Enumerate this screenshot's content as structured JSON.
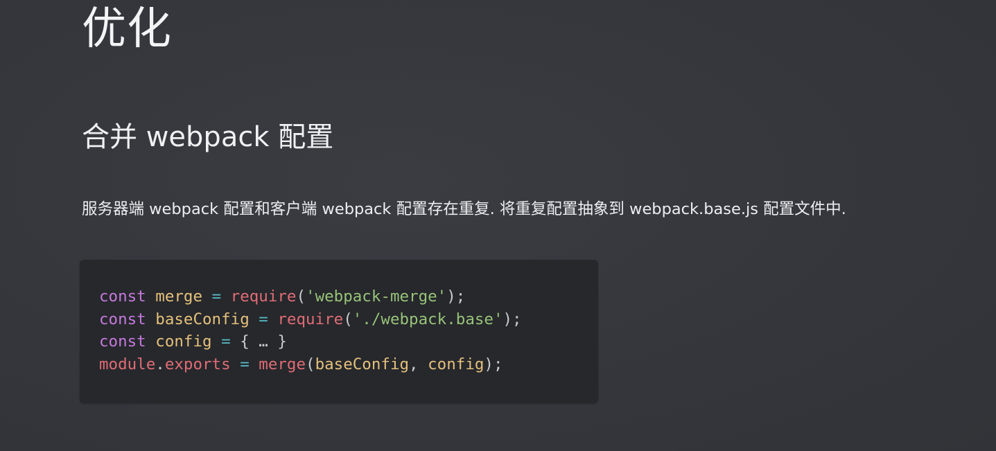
{
  "heading": "优化",
  "subheading": "合并 webpack 配置",
  "paragraph": "服务器端 webpack 配置和客户端 webpack 配置存在重复. 将重复配置抽象到 webpack.base.js 配置文件中.",
  "code_block": {
    "lines": [
      [
        {
          "type": "kw",
          "text": "const"
        },
        {
          "type": "punc",
          "text": " "
        },
        {
          "type": "var",
          "text": "merge"
        },
        {
          "type": "punc",
          "text": " "
        },
        {
          "type": "op",
          "text": "="
        },
        {
          "type": "punc",
          "text": " "
        },
        {
          "type": "fn",
          "text": "require"
        },
        {
          "type": "punc",
          "text": "("
        },
        {
          "type": "str",
          "text": "'webpack-merge'"
        },
        {
          "type": "punc",
          "text": ");"
        }
      ],
      [
        {
          "type": "kw",
          "text": "const"
        },
        {
          "type": "punc",
          "text": " "
        },
        {
          "type": "var",
          "text": "baseConfig"
        },
        {
          "type": "punc",
          "text": " "
        },
        {
          "type": "op",
          "text": "="
        },
        {
          "type": "punc",
          "text": " "
        },
        {
          "type": "fn",
          "text": "require"
        },
        {
          "type": "punc",
          "text": "("
        },
        {
          "type": "str",
          "text": "'./webpack.base'"
        },
        {
          "type": "punc",
          "text": ");"
        }
      ],
      [
        {
          "type": "kw",
          "text": "const"
        },
        {
          "type": "punc",
          "text": " "
        },
        {
          "type": "var",
          "text": "config"
        },
        {
          "type": "punc",
          "text": " "
        },
        {
          "type": "op",
          "text": "="
        },
        {
          "type": "punc",
          "text": " { … }"
        }
      ],
      [
        {
          "type": "fn",
          "text": "module"
        },
        {
          "type": "punc",
          "text": "."
        },
        {
          "type": "fn",
          "text": "exports"
        },
        {
          "type": "punc",
          "text": " "
        },
        {
          "type": "op",
          "text": "="
        },
        {
          "type": "punc",
          "text": " "
        },
        {
          "type": "fn",
          "text": "merge"
        },
        {
          "type": "punc",
          "text": "("
        },
        {
          "type": "var",
          "text": "baseConfig"
        },
        {
          "type": "punc",
          "text": ", "
        },
        {
          "type": "var",
          "text": "config"
        },
        {
          "type": "punc",
          "text": ");"
        }
      ]
    ]
  },
  "colors": {
    "background": "#35373d",
    "code_background": "#26282c",
    "text": "#f1f2f4",
    "keyword": "#c678dd",
    "variable": "#e5c07b",
    "operator": "#56b6c2",
    "function": "#e06c75",
    "string": "#98c379"
  }
}
